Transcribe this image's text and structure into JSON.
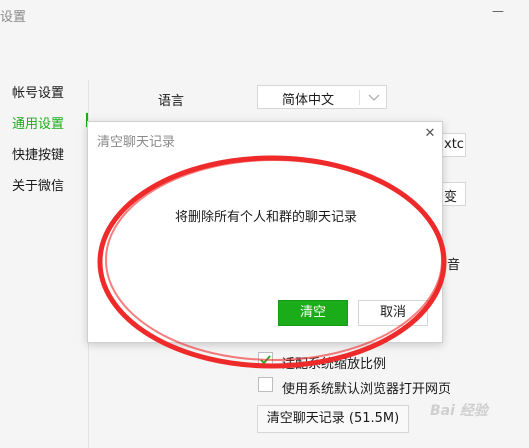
{
  "window": {
    "title": "设置",
    "minimize_icon": "minimize-icon"
  },
  "sidebar": {
    "items": [
      {
        "label": "帐号设置",
        "active": false
      },
      {
        "label": "通用设置",
        "active": true
      },
      {
        "label": "快捷按键",
        "active": false
      },
      {
        "label": "关于微信",
        "active": false
      }
    ],
    "accent_color": "#1aad19"
  },
  "settings": {
    "language_label": "语言",
    "language_value": "简体中文",
    "partial_right_1": "xtc",
    "partial_right_2": "变",
    "partial_right_3": "音",
    "checkbox_scale_label": "适配系统缩放比例",
    "checkbox_scale_checked": true,
    "checkbox_browser_label": "使用系统默认浏览器打开网页",
    "checkbox_browser_checked": false,
    "clear_history_button": "清空聊天记录 (51.5M)"
  },
  "dialog": {
    "title": "清空聊天记录",
    "message": "将删除所有个人和群的聊天记录",
    "confirm_label": "清空",
    "cancel_label": "取消",
    "close_icon": "close-icon"
  },
  "annotation": {
    "shape": "ellipse",
    "color": "#ee2a2a"
  },
  "watermark": {
    "text": "Bai 经验"
  }
}
